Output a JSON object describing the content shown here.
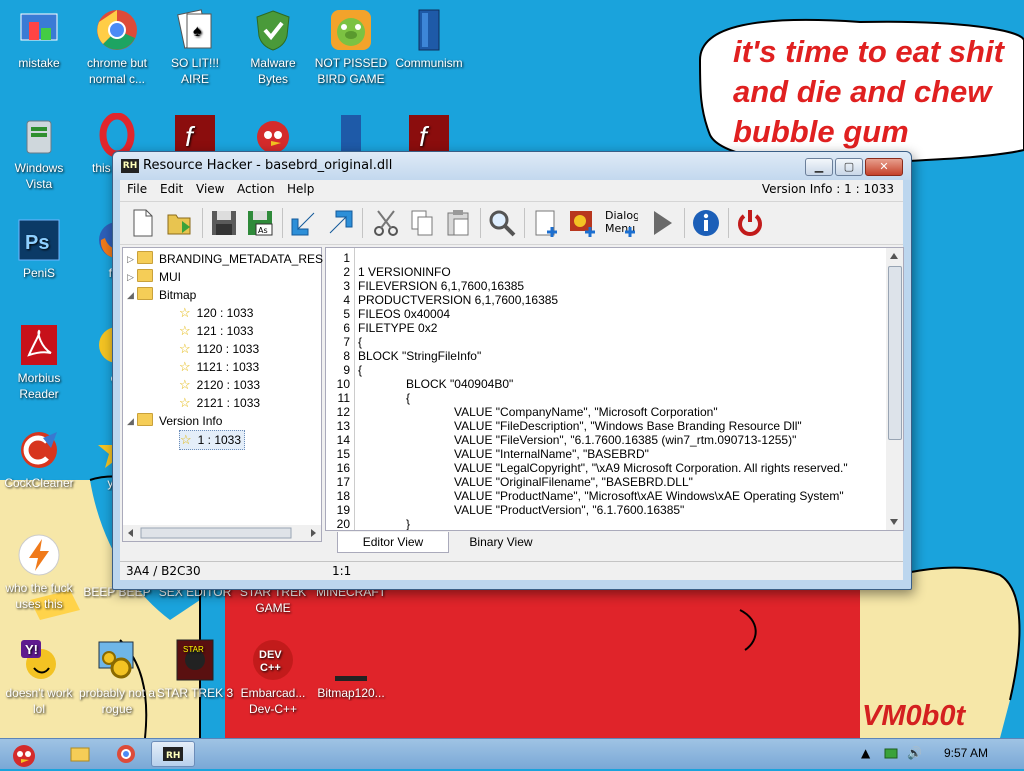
{
  "desktop": {
    "icons": [
      {
        "label": "mistake"
      },
      {
        "label": "chrome but normal c..."
      },
      {
        "label": "SO LIT!!! AIRE"
      },
      {
        "label": "Malware Bytes"
      },
      {
        "label": "NOT PISSED BIRD GAME"
      },
      {
        "label": "Communism"
      },
      {
        "label": "Windows Vista"
      },
      {
        "label": "this like a"
      },
      {
        "label": "PeniS"
      },
      {
        "label": "furi"
      },
      {
        "label": "Morbius Reader"
      },
      {
        "label": "cd"
      },
      {
        "label": "CockCleaner"
      },
      {
        "label": "you"
      },
      {
        "label": "who the fuck uses this"
      },
      {
        "label": "BEEP BEEP"
      },
      {
        "label": "SEX EDITOR"
      },
      {
        "label": "STAR TREK GAME"
      },
      {
        "label": "MINECRAFT"
      },
      {
        "label": "doesn't work lol"
      },
      {
        "label": "probably not a rogue"
      },
      {
        "label": "STAR TREK 3"
      },
      {
        "label": "Embarcad... Dev-C++"
      },
      {
        "label": "Bitmap120..."
      }
    ],
    "bubble_text": "it's time to eat shit\nand die and chew\nbubble gum",
    "watermark": "VM0b0t"
  },
  "window": {
    "title": "Resource Hacker - basebrd_original.dll",
    "menu": [
      "File",
      "Edit",
      "View",
      "Action",
      "Help"
    ],
    "menu_right": "Version Info : 1 : 1033",
    "toolbar": [
      {
        "name": "new-icon"
      },
      {
        "name": "open-icon"
      },
      {
        "name": "save-icon"
      },
      {
        "name": "save-as-icon"
      },
      {
        "name": "import-icon"
      },
      {
        "name": "export-icon"
      },
      {
        "name": "cut-icon"
      },
      {
        "name": "copy-icon"
      },
      {
        "name": "paste-icon"
      },
      {
        "name": "find-icon"
      },
      {
        "name": "add-resource-icon"
      },
      {
        "name": "add-image-icon"
      },
      {
        "name": "dialog-menu-icon",
        "label": "Dialog Menu"
      },
      {
        "name": "compile-icon"
      },
      {
        "name": "info-icon"
      },
      {
        "name": "power-icon"
      }
    ],
    "tree": [
      {
        "label": "BRANDING_METADATA_RES",
        "type": "folder",
        "expand": "▷",
        "level": 0
      },
      {
        "label": "MUI",
        "type": "folder",
        "expand": "▷",
        "level": 0
      },
      {
        "label": "Bitmap",
        "type": "folder",
        "expand": "◢",
        "level": 0
      },
      {
        "label": "120 : 1033",
        "type": "star",
        "level": 1
      },
      {
        "label": "121 : 1033",
        "type": "star",
        "level": 1
      },
      {
        "label": "1120 : 1033",
        "type": "star",
        "level": 1
      },
      {
        "label": "1121 : 1033",
        "type": "star",
        "level": 1
      },
      {
        "label": "2120 : 1033",
        "type": "star",
        "level": 1
      },
      {
        "label": "2121 : 1033",
        "type": "star",
        "level": 1
      },
      {
        "label": "Version Info",
        "type": "folder",
        "expand": "◢",
        "level": 0
      },
      {
        "label": "1 : 1033",
        "type": "star",
        "level": 1,
        "selected": true
      }
    ],
    "editor": {
      "line_numbers": [
        "1",
        "2",
        "3",
        "4",
        "5",
        "6",
        "7",
        "8",
        "9",
        "10",
        "11",
        "12",
        "13",
        "14",
        "15",
        "16",
        "17",
        "18",
        "19",
        "20"
      ],
      "lines": [
        {
          "indent": 0,
          "text": ""
        },
        {
          "indent": 0,
          "text": "1 VERSIONINFO"
        },
        {
          "indent": 0,
          "text": "FILEVERSION 6,1,7600,16385"
        },
        {
          "indent": 0,
          "text": "PRODUCTVERSION 6,1,7600,16385"
        },
        {
          "indent": 0,
          "text": "FILEOS 0x40004"
        },
        {
          "indent": 0,
          "text": "FILETYPE 0x2"
        },
        {
          "indent": 0,
          "text": "{"
        },
        {
          "indent": 0,
          "text": "BLOCK \"StringFileInfo\""
        },
        {
          "indent": 0,
          "text": "{"
        },
        {
          "indent": 1,
          "text": "BLOCK \"040904B0\""
        },
        {
          "indent": 1,
          "text": "{"
        },
        {
          "indent": 2,
          "text": "VALUE \"CompanyName\", \"Microsoft Corporation\""
        },
        {
          "indent": 2,
          "text": "VALUE \"FileDescription\", \"Windows Base Branding Resource Dll\""
        },
        {
          "indent": 2,
          "text": "VALUE \"FileVersion\", \"6.1.7600.16385 (win7_rtm.090713-1255)\""
        },
        {
          "indent": 2,
          "text": "VALUE \"InternalName\", \"BASEBRD\""
        },
        {
          "indent": 2,
          "text": "VALUE \"LegalCopyright\", \"\\xA9 Microsoft Corporation. All rights reserved.\""
        },
        {
          "indent": 2,
          "text": "VALUE \"OriginalFilename\", \"BASEBRD.DLL\""
        },
        {
          "indent": 2,
          "text": "VALUE \"ProductName\", \"Microsoft\\xAE Windows\\xAE Operating System\""
        },
        {
          "indent": 2,
          "text": "VALUE \"ProductVersion\", \"6.1.7600.16385\""
        },
        {
          "indent": 1,
          "text": "}"
        }
      ]
    },
    "tabs": [
      {
        "label": "Editor View",
        "active": true
      },
      {
        "label": "Binary View",
        "active": false
      }
    ],
    "status_left": "3A4 / B2C30",
    "status_mid": "1:1"
  },
  "taskbar": {
    "clock": "9:57 AM",
    "tray_arrow": "▲",
    "volume_icon": "🔊"
  },
  "colors": {
    "desktop_blue": "#1aa3dc",
    "bubble_red": "#e02020"
  }
}
